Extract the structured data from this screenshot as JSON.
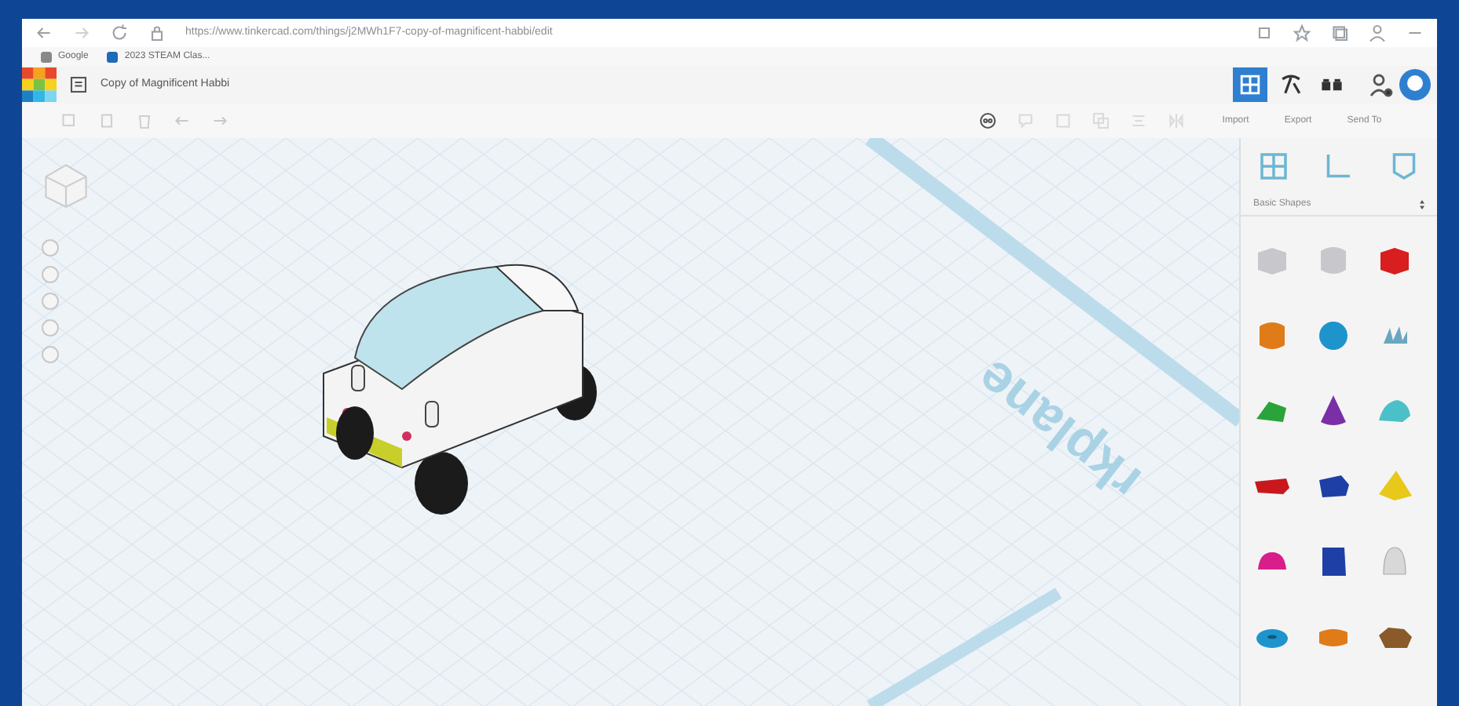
{
  "browser": {
    "url": "https://www.tinkercad.com/things/j2MWh1F7-copy-of-magnificent-habbi/edit",
    "bookmarks": [
      {
        "label": "Google"
      },
      {
        "label": "2023 STEAM Clas..."
      }
    ]
  },
  "header": {
    "title": "Copy of Magnificent Habbi",
    "views": [
      {
        "kind": "grid",
        "selected": true
      },
      {
        "kind": "hammer",
        "selected": false
      },
      {
        "kind": "bricks",
        "selected": false
      }
    ]
  },
  "panel_actions": [
    {
      "label": "Import"
    },
    {
      "label": "Export"
    },
    {
      "label": "Send To"
    }
  ],
  "shape_category": "Basic Shapes",
  "shapes": [
    {
      "kind": "box",
      "color": "#c8c8cc"
    },
    {
      "kind": "cylinder",
      "color": "#c8c8cc"
    },
    {
      "kind": "box",
      "color": "#d81e1e"
    },
    {
      "kind": "cylinder",
      "color": "#e07b1a"
    },
    {
      "kind": "sphere",
      "color": "#1e94cc"
    },
    {
      "kind": "scribble",
      "color": "#6aa6c0"
    },
    {
      "kind": "roof",
      "color": "#2aa33a"
    },
    {
      "kind": "cone",
      "color": "#7a2fa6"
    },
    {
      "kind": "dome",
      "color": "#4cc0c8"
    },
    {
      "kind": "text",
      "color": "#c8181e"
    },
    {
      "kind": "polygon",
      "color": "#1e3fa6"
    },
    {
      "kind": "pyramid",
      "color": "#e8c81a"
    },
    {
      "kind": "half_sphere",
      "color": "#d81e8a"
    },
    {
      "kind": "prism",
      "color": "#1e3fa6"
    },
    {
      "kind": "paraboloid",
      "color": "#d8d8d8"
    },
    {
      "kind": "torus",
      "color": "#1e94cc"
    },
    {
      "kind": "tube",
      "color": "#e07b1a"
    },
    {
      "kind": "rock",
      "color": "#8a5a2a"
    }
  ],
  "workplane_label": "rkplane"
}
